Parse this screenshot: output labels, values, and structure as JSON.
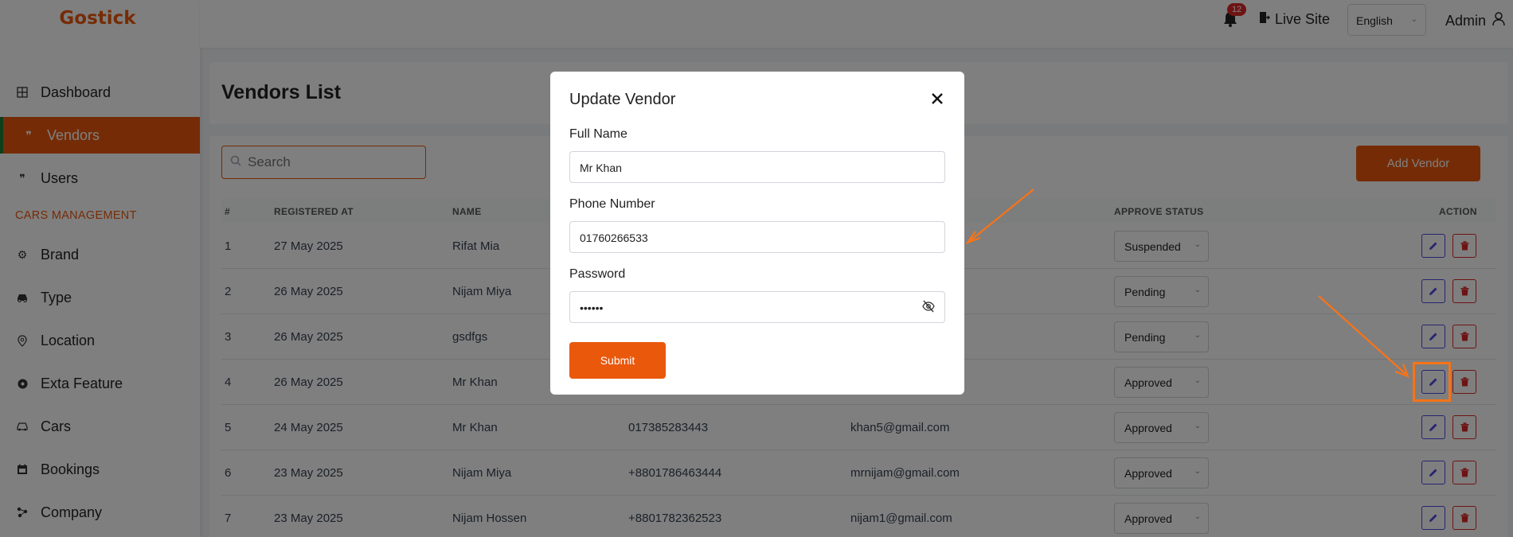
{
  "brand": "Gostick",
  "sidebar": {
    "items": [
      {
        "label": "Dashboard",
        "icon": "grid-icon"
      },
      {
        "label": "Vendors",
        "icon": "quote-icon",
        "active": true
      },
      {
        "label": "Users",
        "icon": "quote-icon"
      },
      {
        "label": "Brand",
        "icon": "cog-icon"
      },
      {
        "label": "Type",
        "icon": "car-icon"
      },
      {
        "label": "Location",
        "icon": "pin-icon"
      },
      {
        "label": "Exta Feature",
        "icon": "circle-icon"
      },
      {
        "label": "Cars",
        "icon": "car-icon"
      },
      {
        "label": "Bookings",
        "icon": "calendar-icon"
      },
      {
        "label": "Company",
        "icon": "network-icon"
      }
    ],
    "section_label": "CARS MANAGEMENT"
  },
  "topbar": {
    "notification_count": "12",
    "live_site": "Live Site",
    "language": "English",
    "user": "Admin"
  },
  "page": {
    "title": "Vendors List",
    "search_placeholder": "Search",
    "add_button": "Add Vendor"
  },
  "table": {
    "headers": {
      "num": "#",
      "registered": "REGISTERED AT",
      "name": "NAME",
      "status": "APPROVE STATUS",
      "action": "ACTION"
    },
    "rows": [
      {
        "num": "1",
        "date": "27 May 2025",
        "name": "Rifat Mia",
        "phone": "",
        "email": "",
        "status": "Suspended"
      },
      {
        "num": "2",
        "date": "26 May 2025",
        "name": "Nijam Miya",
        "phone": "",
        "email": "",
        "status": "Pending"
      },
      {
        "num": "3",
        "date": "26 May 2025",
        "name": "gsdfgs",
        "phone": "",
        "email": "",
        "status": "Pending"
      },
      {
        "num": "4",
        "date": "26 May 2025",
        "name": "Mr Khan",
        "phone": "",
        "email": "",
        "status": "Approved"
      },
      {
        "num": "5",
        "date": "24 May 2025",
        "name": "Mr Khan",
        "phone": "017385283443",
        "email": "khan5@gmail.com",
        "status": "Approved"
      },
      {
        "num": "6",
        "date": "23 May 2025",
        "name": "Nijam Miya",
        "phone": "+8801786463444",
        "email": "mrnijam@gmail.com",
        "status": "Approved"
      },
      {
        "num": "7",
        "date": "23 May 2025",
        "name": "Nijam Hossen",
        "phone": "+8801782362523",
        "email": "nijam1@gmail.com",
        "status": "Approved"
      }
    ]
  },
  "modal": {
    "title": "Update Vendor",
    "full_name_label": "Full Name",
    "full_name_value": "Mr Khan",
    "phone_label": "Phone Number",
    "phone_value": "01760266533",
    "password_label": "Password",
    "password_value": "••••••",
    "submit": "Submit"
  },
  "colors": {
    "accent": "#ea580c",
    "edit": "#4f46e5",
    "delete": "#dc2626",
    "annotation": "#f97316"
  }
}
